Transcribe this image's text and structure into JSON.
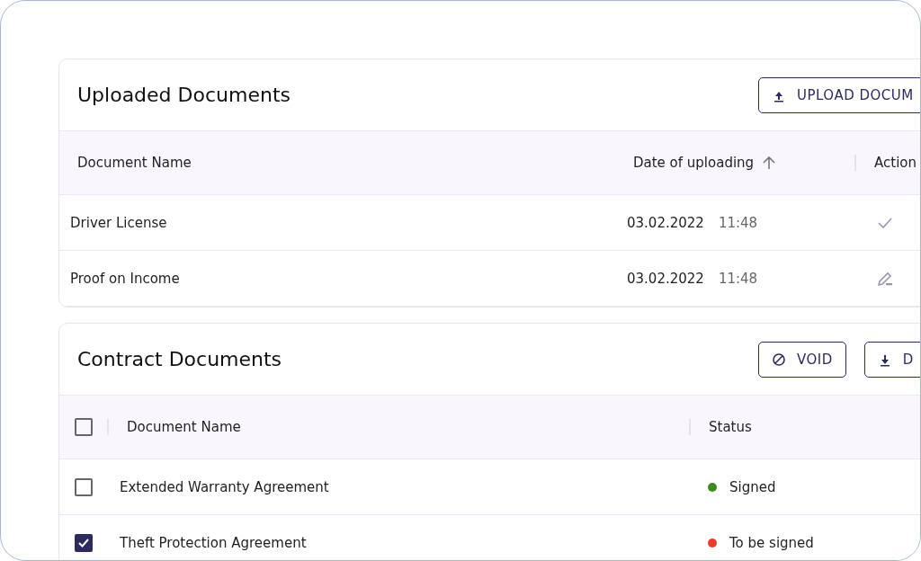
{
  "uploaded": {
    "title": "Uploaded Documents",
    "upload_button": "UPLOAD DOCUM",
    "columns": [
      "Document Name",
      "Date of uploading",
      "Action"
    ],
    "rows": [
      {
        "name": "Driver License",
        "date": "03.02.2022",
        "time": "11:48",
        "kind": "check"
      },
      {
        "name": "Proof on Income",
        "date": "03.02.2022",
        "time": "11:48",
        "kind": "edit"
      }
    ]
  },
  "contracts": {
    "title": "Contract Documents",
    "buttons": [
      {
        "label": "VOID",
        "kind": "void"
      },
      {
        "label": "D",
        "kind": "download"
      }
    ],
    "all_checked": false,
    "columns": [
      "Document Name",
      "Status"
    ],
    "rows": [
      {
        "name": "Extended Warranty Agreement",
        "checked": false,
        "status": "Signed",
        "color": "#3a8a1c"
      },
      {
        "name": "Theft Protection Agreement",
        "checked": true,
        "status": "To be signed",
        "color": "#f0392b"
      }
    ]
  }
}
